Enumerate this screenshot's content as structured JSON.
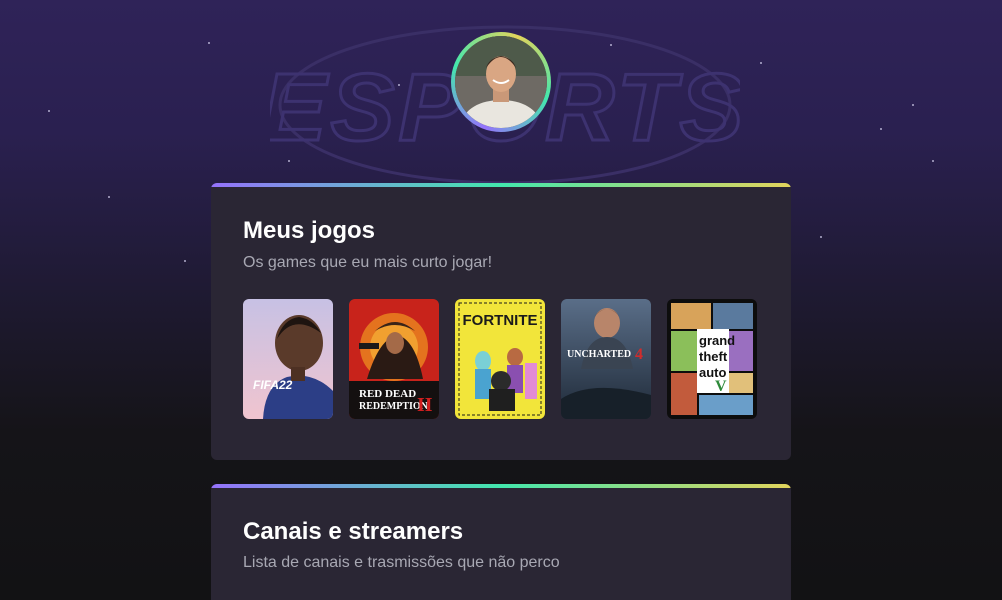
{
  "profile": {
    "avatar_icon": "profile-photo"
  },
  "background": {
    "watermark_text": "ESPORTS"
  },
  "games_section": {
    "title": "Meus jogos",
    "subtitle": "Os games que eu mais curto jogar!",
    "games": [
      {
        "name": "FIFA 22",
        "cover_text": "FIFA22"
      },
      {
        "name": "Red Dead Redemption II",
        "cover_line1": "RED DEAD",
        "cover_line2": "REDEMPTION",
        "cover_numeral": "II"
      },
      {
        "name": "Fortnite",
        "cover_text": "FORTNITE"
      },
      {
        "name": "Uncharted 4",
        "cover_text": "UNCHARTED",
        "cover_numeral": "4"
      },
      {
        "name": "Grand Theft Auto V",
        "cover_line1": "grand",
        "cover_line2": "theft",
        "cover_line3": "auto",
        "cover_numeral": "V"
      }
    ]
  },
  "channels_section": {
    "title": "Canais e streamers",
    "subtitle": "Lista de canais e trasmissões que não perco"
  },
  "colors": {
    "accent_purple": "#9572fc",
    "accent_green": "#43e7ad",
    "accent_yellow": "#e2d45c",
    "card_bg": "#2a2634",
    "text_muted": "#a8a8b3"
  }
}
